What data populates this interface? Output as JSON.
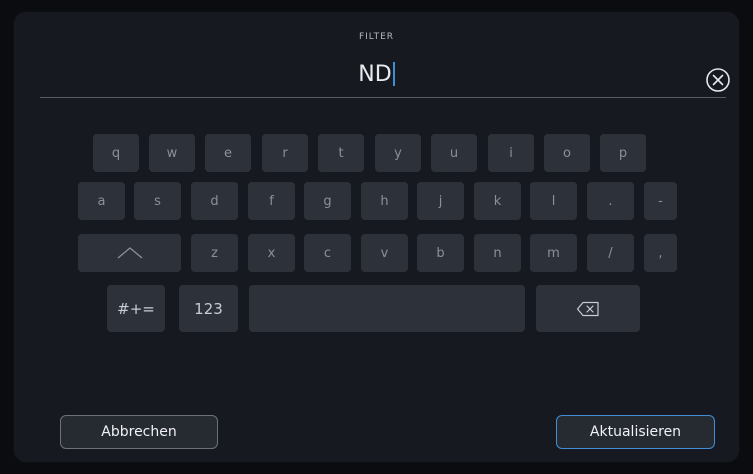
{
  "filter": {
    "label": "FILTER",
    "value": "ND",
    "clear_icon": "circle-x-icon"
  },
  "keyboard": {
    "row1": [
      "q",
      "w",
      "e",
      "r",
      "t",
      "y",
      "u",
      "i",
      "o",
      "p"
    ],
    "row2": [
      "a",
      "s",
      "d",
      "f",
      "g",
      "h",
      "j",
      "k",
      "l",
      ".",
      "-"
    ],
    "row3": [
      "z",
      "x",
      "c",
      "v",
      "b",
      "n",
      "m",
      "/",
      ","
    ],
    "shift_icon": "caret-up-icon",
    "symbols_label": "#+=",
    "numbers_label": "123",
    "backspace_icon": "backspace-icon"
  },
  "actions": {
    "cancel_label": "Abbrechen",
    "update_label": "Aktualisieren"
  },
  "colors": {
    "accent": "#3f8ed6",
    "panel": "#16191f",
    "key": "#2d323a"
  }
}
